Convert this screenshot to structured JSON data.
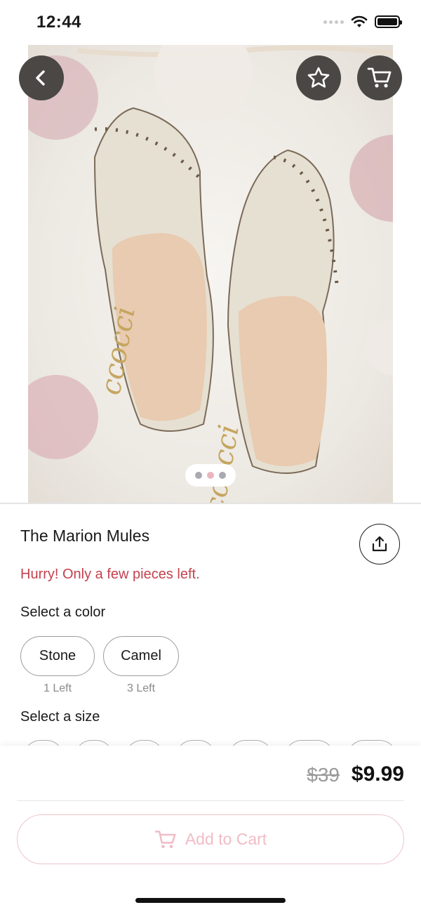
{
  "status_bar": {
    "time": "12:44",
    "icons": [
      "signal-dots-icon",
      "wifi-icon",
      "battery-icon"
    ]
  },
  "gallery": {
    "image_brand_text": "ccocci",
    "page_count": 3,
    "active_page": 2,
    "colors": {
      "active_dot": "#e9b6c0",
      "inactive_dot": "#a9a9b2",
      "button_bg": "#4a4744"
    },
    "icons": {
      "back": "chevron-left-icon",
      "favorite": "star-icon",
      "cart": "cart-icon"
    }
  },
  "product": {
    "title": "The Marion Mules",
    "stock_warning": "Hurry! Only a few pieces left.",
    "share_icon": "share-icon",
    "color_heading": "Select a color",
    "colors": [
      {
        "label": "Stone",
        "stock": "1 Left"
      },
      {
        "label": "Camel",
        "stock": "3 Left"
      }
    ],
    "size_heading": "Select a size"
  },
  "purchase": {
    "original_price": "$39",
    "sale_price": "$9.99",
    "add_to_cart_label": "Add to Cart",
    "cart_icon": "cart-icon",
    "accent_color": "#f0bcc5",
    "warning_color": "#c4414f"
  }
}
